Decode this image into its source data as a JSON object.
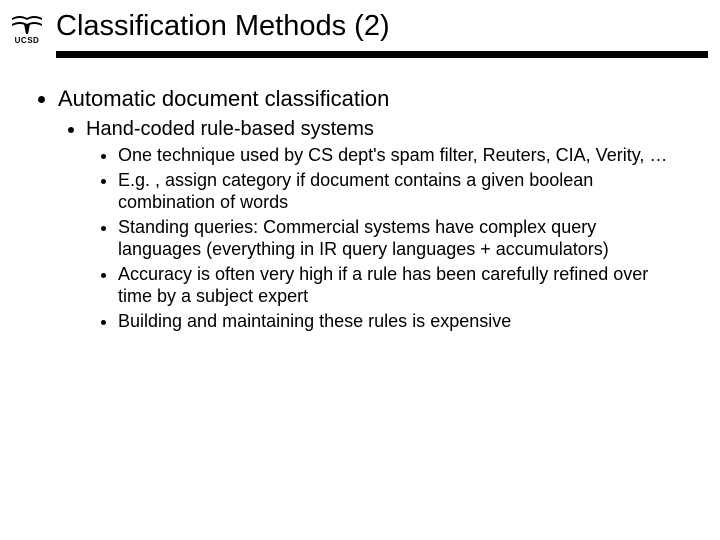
{
  "logo": {
    "label": "UCSD"
  },
  "title": "Classification Methods (2)",
  "bullets": {
    "l1": "Automatic document classification",
    "l2": "Hand-coded rule-based systems",
    "l3": [
      "One technique used by CS dept's spam filter, Reuters, CIA, Verity, …",
      "E.g. , assign category if document contains a given boolean combination of words",
      "Standing queries: Commercial systems have complex query languages (everything in IR query languages + accumulators)",
      "Accuracy is often very high if a rule has been carefully refined over time by a subject expert",
      "Building and maintaining these rules is expensive"
    ]
  }
}
